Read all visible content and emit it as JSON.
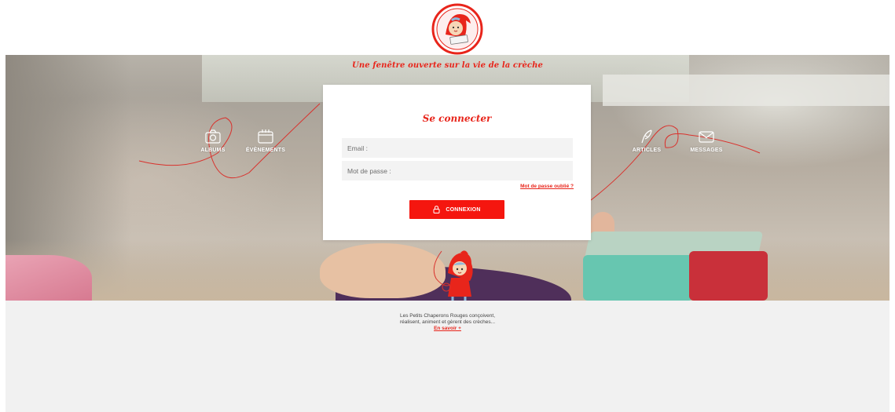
{
  "logo": {
    "icon": "petits-chaperons-rouges-logo"
  },
  "hero": {
    "tagline": "Une fenêtre ouverte sur la vie de la crèche"
  },
  "nav": {
    "left": [
      {
        "label": "ALBUMS",
        "icon": "camera-icon"
      },
      {
        "label": "ÉVÈNEMENTS",
        "icon": "calendar-icon"
      }
    ],
    "right": [
      {
        "label": "ARTICLES",
        "icon": "quill-pen-icon"
      },
      {
        "label": "MESSAGES",
        "icon": "envelope-icon"
      }
    ]
  },
  "login": {
    "title": "Se connecter",
    "email_placeholder": "Email :",
    "password_placeholder": "Mot de passe :",
    "forgot_link": "Mot de passe oublié ?",
    "submit_label": "CONNEXION",
    "submit_icon": "lock-icon"
  },
  "footer": {
    "line1": "Les Petits Chaperons Rouges conçoivent,",
    "line2": "réalisent, animent et gèrent des crèches...",
    "link": "En savoir +"
  },
  "colors": {
    "brand_red": "#e8251b",
    "button_red": "#f5160f",
    "footer_bg": "#f1f1f1"
  }
}
